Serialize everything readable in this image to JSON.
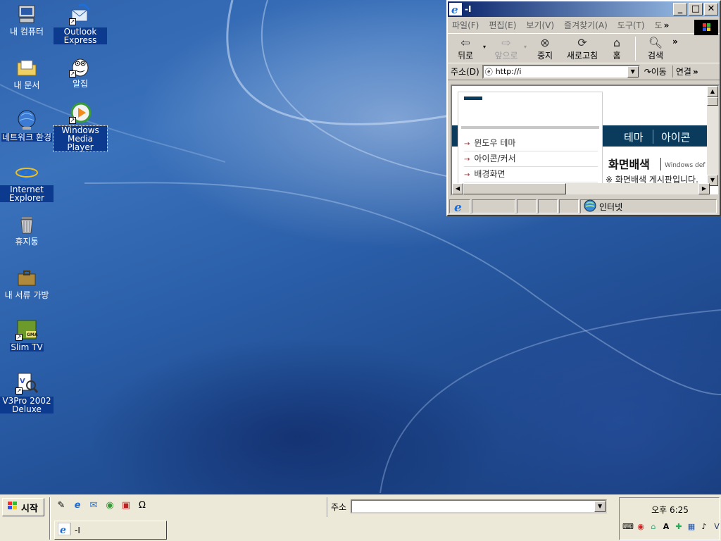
{
  "desktop": {
    "icons": [
      {
        "label": "내 컴퓨터"
      },
      {
        "label": "Outlook Express"
      },
      {
        "label": "내 문서"
      },
      {
        "label": "알집"
      },
      {
        "label": "네트워크 환경"
      },
      {
        "label": "Windows Media Player"
      },
      {
        "label": "Internet Explorer"
      },
      {
        "label": "휴지통"
      },
      {
        "label": "내 서류 가방"
      },
      {
        "label": "Slim TV"
      },
      {
        "label": "V3Pro 2002 Deluxe"
      }
    ],
    "slim_tv_logo_text": "GMA"
  },
  "ie_window": {
    "title": "-I",
    "menu": [
      "파일(F)",
      "편집(E)",
      "보기(V)",
      "즐겨찾기(A)",
      "도구(T)",
      "도"
    ],
    "menu_more": "»",
    "toolbar": {
      "back": "뒤로",
      "forward": "앞으로",
      "stop": "중지",
      "refresh": "새로고침",
      "home": "홈",
      "search": "검색",
      "more": "»"
    },
    "address": {
      "label": "주소(D)",
      "value": "http://i",
      "go": "이동",
      "links": "연결",
      "more": "»"
    },
    "page": {
      "nav": [
        "테마",
        "아이콘"
      ],
      "menu_items": [
        "윈도우 테마",
        "아이콘/커서",
        "배경화면"
      ],
      "heading": "화면배색",
      "heading_sub": "Windows def",
      "notice": "※ 화면배색 게시판입니다."
    },
    "status": {
      "zone": "인터넷"
    }
  },
  "taskbar": {
    "start": "시작",
    "address_label": "주소",
    "address_value": "",
    "task_button": "-I",
    "clock": "오후 6:25"
  }
}
